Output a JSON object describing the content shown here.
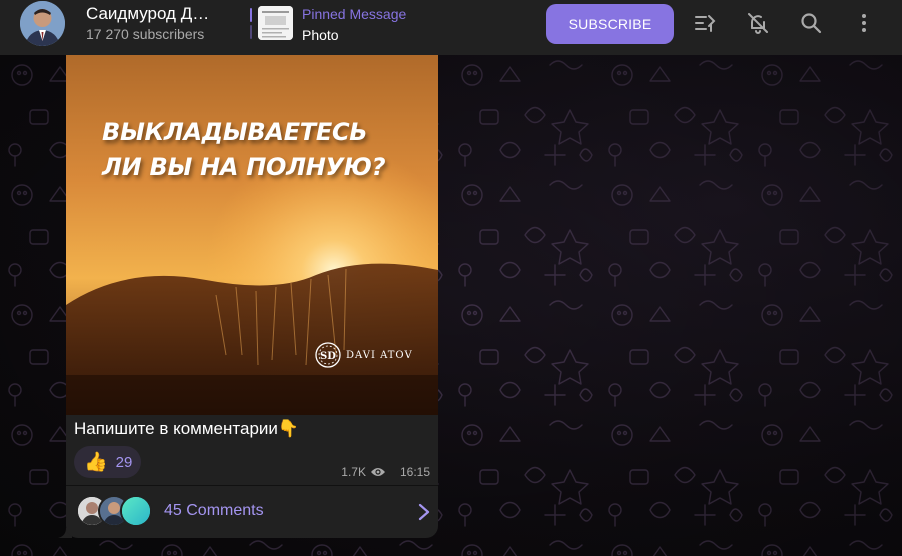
{
  "header": {
    "channel_title": "Саидмурод Д…",
    "subscribers": "17 270 subscribers",
    "pinned_label": "Pinned Message",
    "pinned_text": "Photo",
    "subscribe_label": "SUBSCRIBE",
    "icons": [
      "topics-icon",
      "mute-bell-icon",
      "search-icon",
      "more-vertical-icon"
    ]
  },
  "message": {
    "photo_headline": "ВЫКЛАДЫВАЕТЕСЬ\nЛИ ВЫ НА ПОЛНУЮ?",
    "photo_logo": "DAVI ATOV",
    "caption": "Напишите в комментарии👇",
    "reaction": {
      "emoji": "👍",
      "count": "29"
    },
    "views": "1.7K",
    "time": "16:15",
    "comments_label": "45 Comments"
  },
  "colors": {
    "accent": "#8774e1",
    "header_bg": "#212121",
    "bubble_bg": "#212121"
  }
}
